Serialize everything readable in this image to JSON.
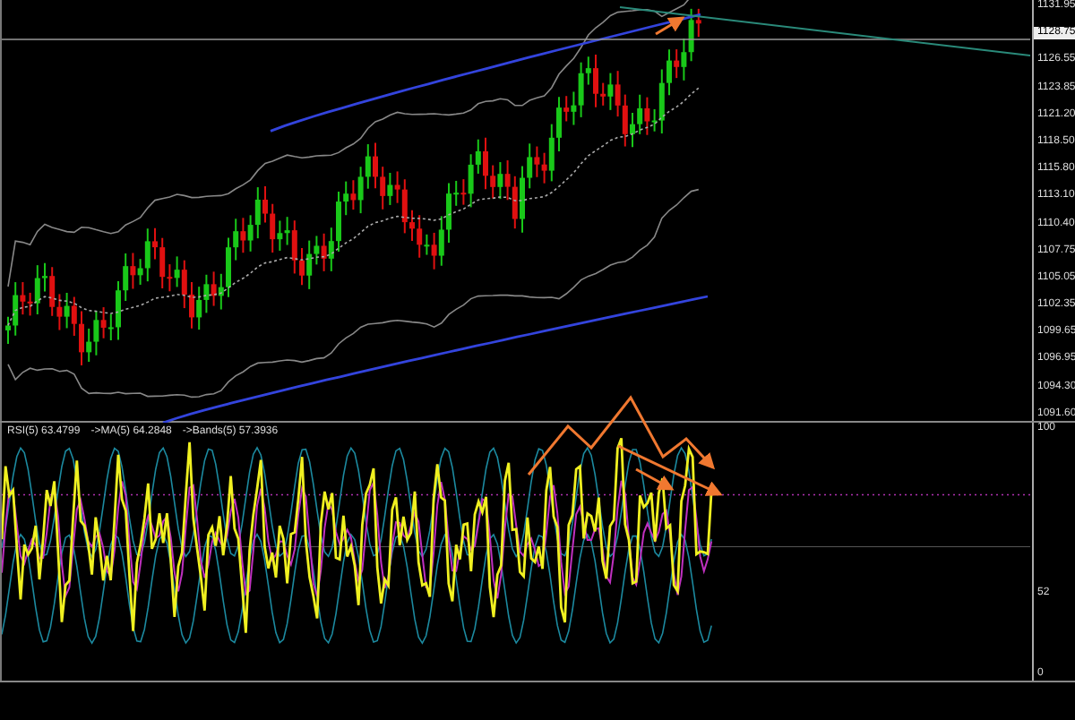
{
  "price_axis": {
    "labels": [
      {
        "kind": "tick",
        "text": "1131.95"
      },
      {
        "kind": "current",
        "text": "1128.75"
      },
      {
        "kind": "tick",
        "text": "1126.55"
      },
      {
        "kind": "tick",
        "text": "1123.85"
      },
      {
        "kind": "tick",
        "text": "1121.20"
      },
      {
        "kind": "tick",
        "text": "1118.50"
      },
      {
        "kind": "tick",
        "text": "1115.80"
      },
      {
        "kind": "tick",
        "text": "1113.10"
      },
      {
        "kind": "tick",
        "text": "1110.40"
      },
      {
        "kind": "tick",
        "text": "1107.75"
      },
      {
        "kind": "tick",
        "text": "1105.05"
      },
      {
        "kind": "tick",
        "text": "1102.35"
      },
      {
        "kind": "tick",
        "text": "1099.65"
      },
      {
        "kind": "tick",
        "text": "1096.95"
      },
      {
        "kind": "tick",
        "text": "1094.30"
      },
      {
        "kind": "tick",
        "text": "1091.60"
      }
    ]
  },
  "indicator": {
    "legend": [
      "RSI(5) 63.4799",
      "->MA(5) 64.2848",
      "->Bands(5) 57.3936"
    ]
  },
  "indicator_axis": {
    "labels": [
      "100",
      "52",
      "0"
    ]
  }
}
